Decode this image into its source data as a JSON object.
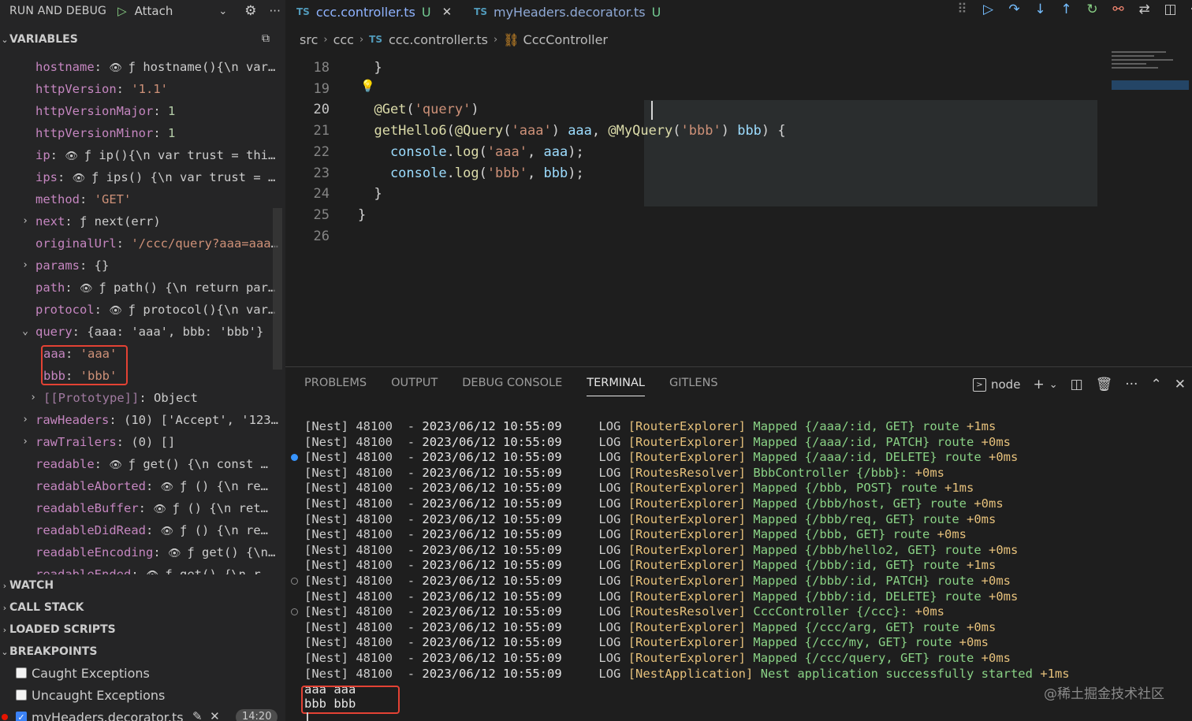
{
  "debug_toolbar": {
    "title": "RUN AND DEBUG",
    "config": "Attach"
  },
  "sections": {
    "variables": "VARIABLES",
    "watch": "WATCH",
    "call_stack": "CALL STACK",
    "loaded_scripts": "LOADED SCRIPTS",
    "breakpoints": "BREAKPOINTS"
  },
  "variables": [
    {
      "key": "hostname",
      "eye": true,
      "value": "ƒ hostname(){\\n  var t…",
      "vtype": "fn",
      "twisty": "",
      "indent": 0
    },
    {
      "key": "httpVersion",
      "eye": false,
      "value": "'1.1'",
      "vtype": "str",
      "twisty": "",
      "indent": 0
    },
    {
      "key": "httpVersionMajor",
      "eye": false,
      "value": "1",
      "vtype": "num",
      "twisty": "",
      "indent": 0
    },
    {
      "key": "httpVersionMinor",
      "eye": false,
      "value": "1",
      "vtype": "num",
      "twisty": "",
      "indent": 0
    },
    {
      "key": "ip",
      "eye": true,
      "value": "ƒ ip(){\\n  var trust = this.a…",
      "vtype": "fn",
      "twisty": "",
      "indent": 0
    },
    {
      "key": "ips",
      "eye": true,
      "value": "ƒ ips() {\\n  var trust = thi…",
      "vtype": "fn",
      "twisty": "",
      "indent": 0
    },
    {
      "key": "method",
      "eye": false,
      "value": "'GET'",
      "vtype": "str",
      "twisty": "",
      "indent": 0
    },
    {
      "key": "next",
      "eye": false,
      "value": "ƒ next(err)",
      "vtype": "fn",
      "twisty": "›",
      "indent": 0
    },
    {
      "key": "originalUrl",
      "eye": false,
      "value": "'/ccc/query?aaa=aaa&bbb…",
      "vtype": "str",
      "twisty": "",
      "indent": 0
    },
    {
      "key": "params",
      "eye": false,
      "value": "{}",
      "vtype": "plain",
      "twisty": "›",
      "indent": 0
    },
    {
      "key": "path",
      "eye": true,
      "value": "ƒ path() {\\n  return parse(…",
      "vtype": "fn",
      "twisty": "",
      "indent": 0
    },
    {
      "key": "protocol",
      "eye": true,
      "value": "ƒ protocol(){\\n  var pr…",
      "vtype": "fn",
      "twisty": "",
      "indent": 0
    },
    {
      "key": "query",
      "eye": false,
      "value": "{aaa: 'aaa', bbb: 'bbb'}",
      "vtype": "plain",
      "twisty": "⌄",
      "indent": 0
    },
    {
      "key": "aaa",
      "eye": false,
      "value": "'aaa'",
      "vtype": "str",
      "twisty": "",
      "indent": 1
    },
    {
      "key": "bbb",
      "eye": false,
      "value": "'bbb'",
      "vtype": "str",
      "twisty": "",
      "indent": 1
    },
    {
      "key": "[[Prototype]]",
      "eye": false,
      "value": "Object",
      "vtype": "plain",
      "twisty": "›",
      "indent": 1,
      "dim": true
    },
    {
      "key": "rawHeaders",
      "eye": false,
      "value": "(10) ['Accept', '123', '…",
      "vtype": "plain",
      "twisty": "›",
      "indent": 0
    },
    {
      "key": "rawTrailers",
      "eye": false,
      "value": "(0) []",
      "vtype": "plain",
      "twisty": "›",
      "indent": 0
    },
    {
      "key": "readable",
      "eye": true,
      "value": "ƒ get() {\\n      const …",
      "vtype": "fn",
      "twisty": "",
      "indent": 0
    },
    {
      "key": "readableAborted",
      "eye": true,
      "value": "ƒ () {\\n       re…",
      "vtype": "fn",
      "twisty": "",
      "indent": 0
    },
    {
      "key": "readableBuffer",
      "eye": true,
      "value": "ƒ () {\\n       ret…",
      "vtype": "fn",
      "twisty": "",
      "indent": 0
    },
    {
      "key": "readableDidRead",
      "eye": true,
      "value": "ƒ () {\\n       re…",
      "vtype": "fn",
      "twisty": "",
      "indent": 0
    },
    {
      "key": "readableEncoding",
      "eye": true,
      "value": "ƒ get() {\\n      …",
      "vtype": "fn",
      "twisty": "",
      "indent": 0
    },
    {
      "key": "readableEnded",
      "eye": true,
      "value": "ƒ get() {\\n      r…",
      "vtype": "fn",
      "twisty": "",
      "indent": 0
    }
  ],
  "breakpoints": [
    {
      "label": "Caught Exceptions",
      "checked": false
    },
    {
      "label": "Uncaught Exceptions",
      "checked": false
    },
    {
      "label": "myHeaders.decorator.ts",
      "checked": true,
      "line": "14:20"
    }
  ],
  "tabs": [
    {
      "lang": "TS",
      "name": "ccc.controller.ts",
      "status": "U",
      "active": true
    },
    {
      "lang": "TS",
      "name": "myHeaders.decorator.ts",
      "status": "U",
      "active": false
    }
  ],
  "breadcrumb": {
    "parts": [
      "src",
      "ccc"
    ],
    "file_lang": "TS",
    "file": "ccc.controller.ts",
    "symbol": "CccController"
  },
  "code": [
    {
      "n": "18",
      "html": "<span class='c-punc'>  }</span>"
    },
    {
      "n": "19",
      "html": ""
    },
    {
      "n": "20",
      "html": "<span class='c-dec'>  @Get</span><span class='c-punc'>(</span><span class='c-str'>'query'</span><span class='c-punc'>)</span>",
      "active": true
    },
    {
      "n": "21",
      "html": "<span class='c-fn'>  getHello6</span><span class='c-punc'>(</span><span class='c-dec'>@Query</span><span class='c-punc'>(</span><span class='c-str'>'aaa'</span><span class='c-punc'>) </span><span class='c-param'>aaa</span><span class='c-punc'>, </span><span class='c-dec'>@MyQuery</span><span class='c-punc'>(</span><span class='c-str'>'bbb'</span><span class='c-punc'>) </span><span class='c-param'>bbb</span><span class='c-punc'>) {</span>"
    },
    {
      "n": "22",
      "html": "<span class='c-obj'>    console</span><span class='c-punc'>.</span><span class='c-fn'>log</span><span class='c-punc'>(</span><span class='c-str'>'aaa'</span><span class='c-punc'>, </span><span class='c-param'>aaa</span><span class='c-punc'>);</span>"
    },
    {
      "n": "23",
      "html": "<span class='c-obj'>    console</span><span class='c-punc'>.</span><span class='c-fn'>log</span><span class='c-punc'>(</span><span class='c-str'>'bbb'</span><span class='c-punc'>, </span><span class='c-param'>bbb</span><span class='c-punc'>);</span>"
    },
    {
      "n": "24",
      "html": "<span class='c-punc'>  }</span>"
    },
    {
      "n": "25",
      "html": "<span class='c-punc'>}</span>"
    },
    {
      "n": "26",
      "html": ""
    }
  ],
  "panel_tabs": [
    "PROBLEMS",
    "OUTPUT",
    "DEBUG CONSOLE",
    "TERMINAL",
    "GITLENS"
  ],
  "active_panel_tab": "TERMINAL",
  "terminal_shell": "node",
  "terminal_lines": [
    {
      "ctx": "[RouterExplorer]",
      "msg": "Mapped {/aaa/:id, GET} route",
      "dur": "+1ms",
      "dot": ""
    },
    {
      "ctx": "[RouterExplorer]",
      "msg": "Mapped {/aaa/:id, PATCH} route",
      "dur": "+0ms",
      "dot": ""
    },
    {
      "ctx": "[RouterExplorer]",
      "msg": "Mapped {/aaa/:id, DELETE} route",
      "dur": "+0ms",
      "dot": "filled"
    },
    {
      "ctx": "[RoutesResolver]",
      "msg": "BbbController {/bbb}:",
      "dur": "+0ms",
      "dot": ""
    },
    {
      "ctx": "[RouterExplorer]",
      "msg": "Mapped {/bbb, POST} route",
      "dur": "+1ms",
      "dot": ""
    },
    {
      "ctx": "[RouterExplorer]",
      "msg": "Mapped {/bbb/host, GET} route",
      "dur": "+0ms",
      "dot": ""
    },
    {
      "ctx": "[RouterExplorer]",
      "msg": "Mapped {/bbb/req, GET} route",
      "dur": "+0ms",
      "dot": ""
    },
    {
      "ctx": "[RouterExplorer]",
      "msg": "Mapped {/bbb, GET} route",
      "dur": "+0ms",
      "dot": ""
    },
    {
      "ctx": "[RouterExplorer]",
      "msg": "Mapped {/bbb/hello2, GET} route",
      "dur": "+0ms",
      "dot": ""
    },
    {
      "ctx": "[RouterExplorer]",
      "msg": "Mapped {/bbb/:id, GET} route",
      "dur": "+1ms",
      "dot": ""
    },
    {
      "ctx": "[RouterExplorer]",
      "msg": "Mapped {/bbb/:id, PATCH} route",
      "dur": "+0ms",
      "dot": "hollow"
    },
    {
      "ctx": "[RouterExplorer]",
      "msg": "Mapped {/bbb/:id, DELETE} route",
      "dur": "+0ms",
      "dot": ""
    },
    {
      "ctx": "[RoutesResolver]",
      "msg": "CccController {/ccc}:",
      "dur": "+0ms",
      "dot": "hollow"
    },
    {
      "ctx": "[RouterExplorer]",
      "msg": "Mapped {/ccc/arg, GET} route",
      "dur": "+0ms",
      "dot": ""
    },
    {
      "ctx": "[RouterExplorer]",
      "msg": "Mapped {/ccc/my, GET} route",
      "dur": "+0ms",
      "dot": ""
    },
    {
      "ctx": "[RouterExplorer]",
      "msg": "Mapped {/ccc/query, GET} route",
      "dur": "+0ms",
      "dot": ""
    },
    {
      "ctx": "[NestApplication]",
      "msg": "Nest application successfully started",
      "dur": "+1ms",
      "dot": ""
    }
  ],
  "terminal_prefix": {
    "app": "[Nest]",
    "pid": "48100",
    "dash": "-",
    "time": "2023/06/12 10:55:09",
    "level": "LOG"
  },
  "terminal_output": "aaa aaa\nbbb bbb",
  "watermark": "@稀土掘金技术社区"
}
